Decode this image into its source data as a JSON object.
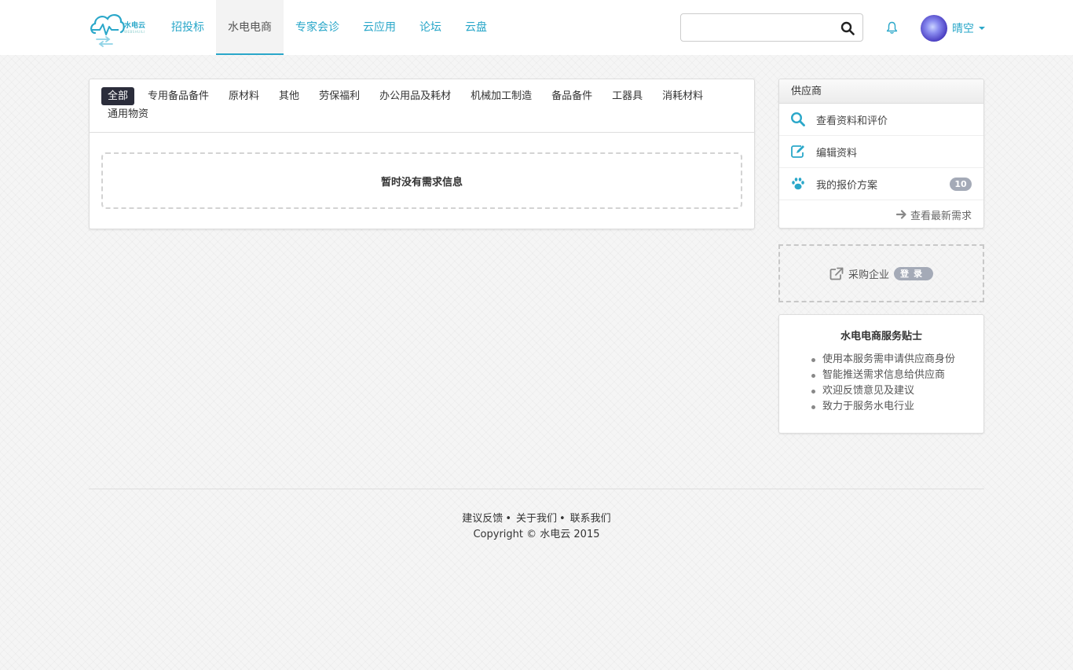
{
  "brand": {
    "logo_text": "水电云",
    "logo_sub": "WEBSHUILI"
  },
  "nav": {
    "items": [
      {
        "label": "招投标"
      },
      {
        "label": "水电电商"
      },
      {
        "label": "专家会诊"
      },
      {
        "label": "云应用"
      },
      {
        "label": "论坛"
      },
      {
        "label": "云盘"
      }
    ],
    "active": "水电电商"
  },
  "search": {
    "value": "",
    "placeholder": ""
  },
  "user": {
    "name": "晴空"
  },
  "categories": {
    "items": [
      "全部",
      "专用备品备件",
      "原材料",
      "其他",
      "劳保福利",
      "办公用品及耗材",
      "机械加工制造",
      "备品备件",
      "工器具",
      "消耗材料",
      "通用物资"
    ],
    "active": "全部"
  },
  "main": {
    "empty_message": "暂时没有需求信息"
  },
  "supplier": {
    "title": "供应商",
    "items": [
      {
        "label": "查看资料和评价",
        "icon": "search-icon"
      },
      {
        "label": "编辑资料",
        "icon": "edit-icon"
      },
      {
        "label": "我的报价方案",
        "icon": "paw-icon",
        "badge": "10"
      }
    ],
    "more_label": "查看最新需求"
  },
  "buyer": {
    "label": "采购企业",
    "login_label": "登录"
  },
  "tips": {
    "title": "水电电商服务贴士",
    "items": [
      "使用本服务需申请供应商身份",
      "智能推送需求信息给供应商",
      "欢迎反馈意见及建议",
      "致力于服务水电行业"
    ]
  },
  "footer": {
    "links": [
      "建议反馈",
      "关于我们",
      "联系我们"
    ],
    "separator": "•",
    "copyright": "Copyright © 水电云 2015"
  },
  "colors": {
    "accent": "#2aa7c9",
    "dark_pill": "#2b2d3b",
    "badge": "#a4aab7"
  }
}
